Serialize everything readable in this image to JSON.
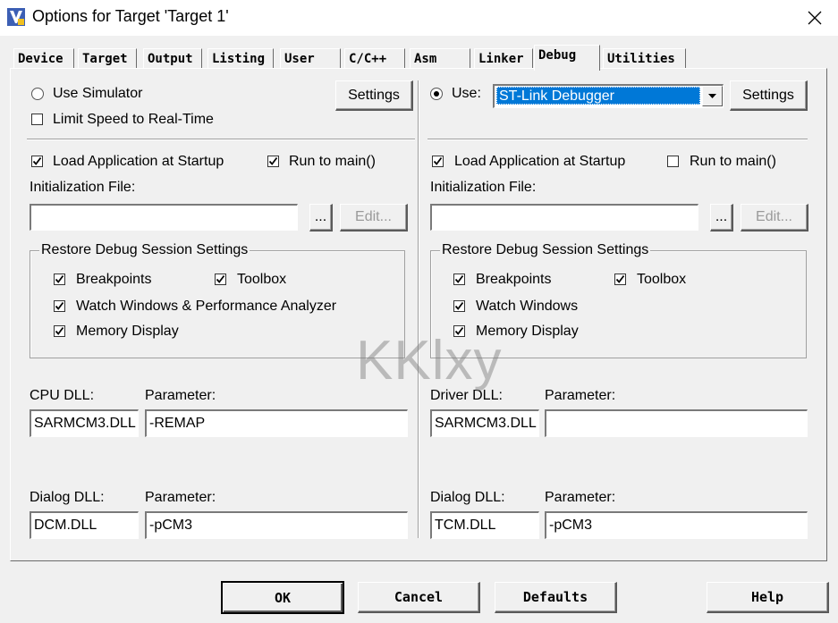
{
  "window": {
    "title": "Options for Target 'Target 1'",
    "icons": [
      "app-icon",
      "close-icon"
    ]
  },
  "tabs": [
    {
      "label": "Device"
    },
    {
      "label": "Target"
    },
    {
      "label": "Output"
    },
    {
      "label": "Listing"
    },
    {
      "label": "User"
    },
    {
      "label": "C/C++"
    },
    {
      "label": "Asm"
    },
    {
      "label": "Linker"
    },
    {
      "label": "Debug",
      "active": true
    },
    {
      "label": "Utilities"
    }
  ],
  "left": {
    "use_simulator": {
      "label": "Use Simulator",
      "checked": false
    },
    "limit_speed": {
      "label": "Limit Speed to Real-Time",
      "checked": false
    },
    "settings_label": "Settings",
    "load_app": {
      "label": "Load Application at Startup",
      "checked": true
    },
    "run_to_main": {
      "label": "Run to main()",
      "checked": true
    },
    "init_file": {
      "label": "Initialization File:",
      "value": "",
      "browse": "...",
      "edit": "Edit..."
    },
    "restore": {
      "title": "Restore Debug Session Settings",
      "breakpoints": {
        "label": "Breakpoints",
        "checked": true
      },
      "toolbox": {
        "label": "Toolbox",
        "checked": true
      },
      "watch": {
        "label": "Watch Windows & Performance Analyzer",
        "checked": true
      },
      "memory": {
        "label": "Memory Display",
        "checked": true
      }
    },
    "cpu_dll": {
      "label": "CPU DLL:",
      "value": "SARMCM3.DLL"
    },
    "cpu_param": {
      "label": "Parameter:",
      "value": "-REMAP"
    },
    "dialog_dll": {
      "label": "Dialog DLL:",
      "value": "DCM.DLL"
    },
    "dialog_param": {
      "label": "Parameter:",
      "value": "-pCM3"
    }
  },
  "right": {
    "use": {
      "label": "Use:",
      "checked": true
    },
    "debugger": {
      "selected": "ST-Link Debugger"
    },
    "settings_label": "Settings",
    "load_app": {
      "label": "Load Application at Startup",
      "checked": true
    },
    "run_to_main": {
      "label": "Run to main()",
      "checked": false
    },
    "init_file": {
      "label": "Initialization File:",
      "value": "",
      "browse": "...",
      "edit": "Edit..."
    },
    "restore": {
      "title": "Restore Debug Session Settings",
      "breakpoints": {
        "label": "Breakpoints",
        "checked": true
      },
      "toolbox": {
        "label": "Toolbox",
        "checked": true
      },
      "watch": {
        "label": "Watch Windows",
        "checked": true
      },
      "memory": {
        "label": "Memory Display",
        "checked": true
      }
    },
    "driver_dll": {
      "label": "Driver DLL:",
      "value": "SARMCM3.DLL"
    },
    "driver_param": {
      "label": "Parameter:",
      "value": ""
    },
    "dialog_dll": {
      "label": "Dialog DLL:",
      "value": "TCM.DLL"
    },
    "dialog_param": {
      "label": "Parameter:",
      "value": "-pCM3"
    }
  },
  "buttons": {
    "ok": "OK",
    "cancel": "Cancel",
    "defaults": "Defaults",
    "help": "Help"
  },
  "watermark": "KKlxy",
  "colors": {
    "selection": "#0078d7",
    "background": "#f0f0f0",
    "app_icon": "#3c5fb4"
  }
}
